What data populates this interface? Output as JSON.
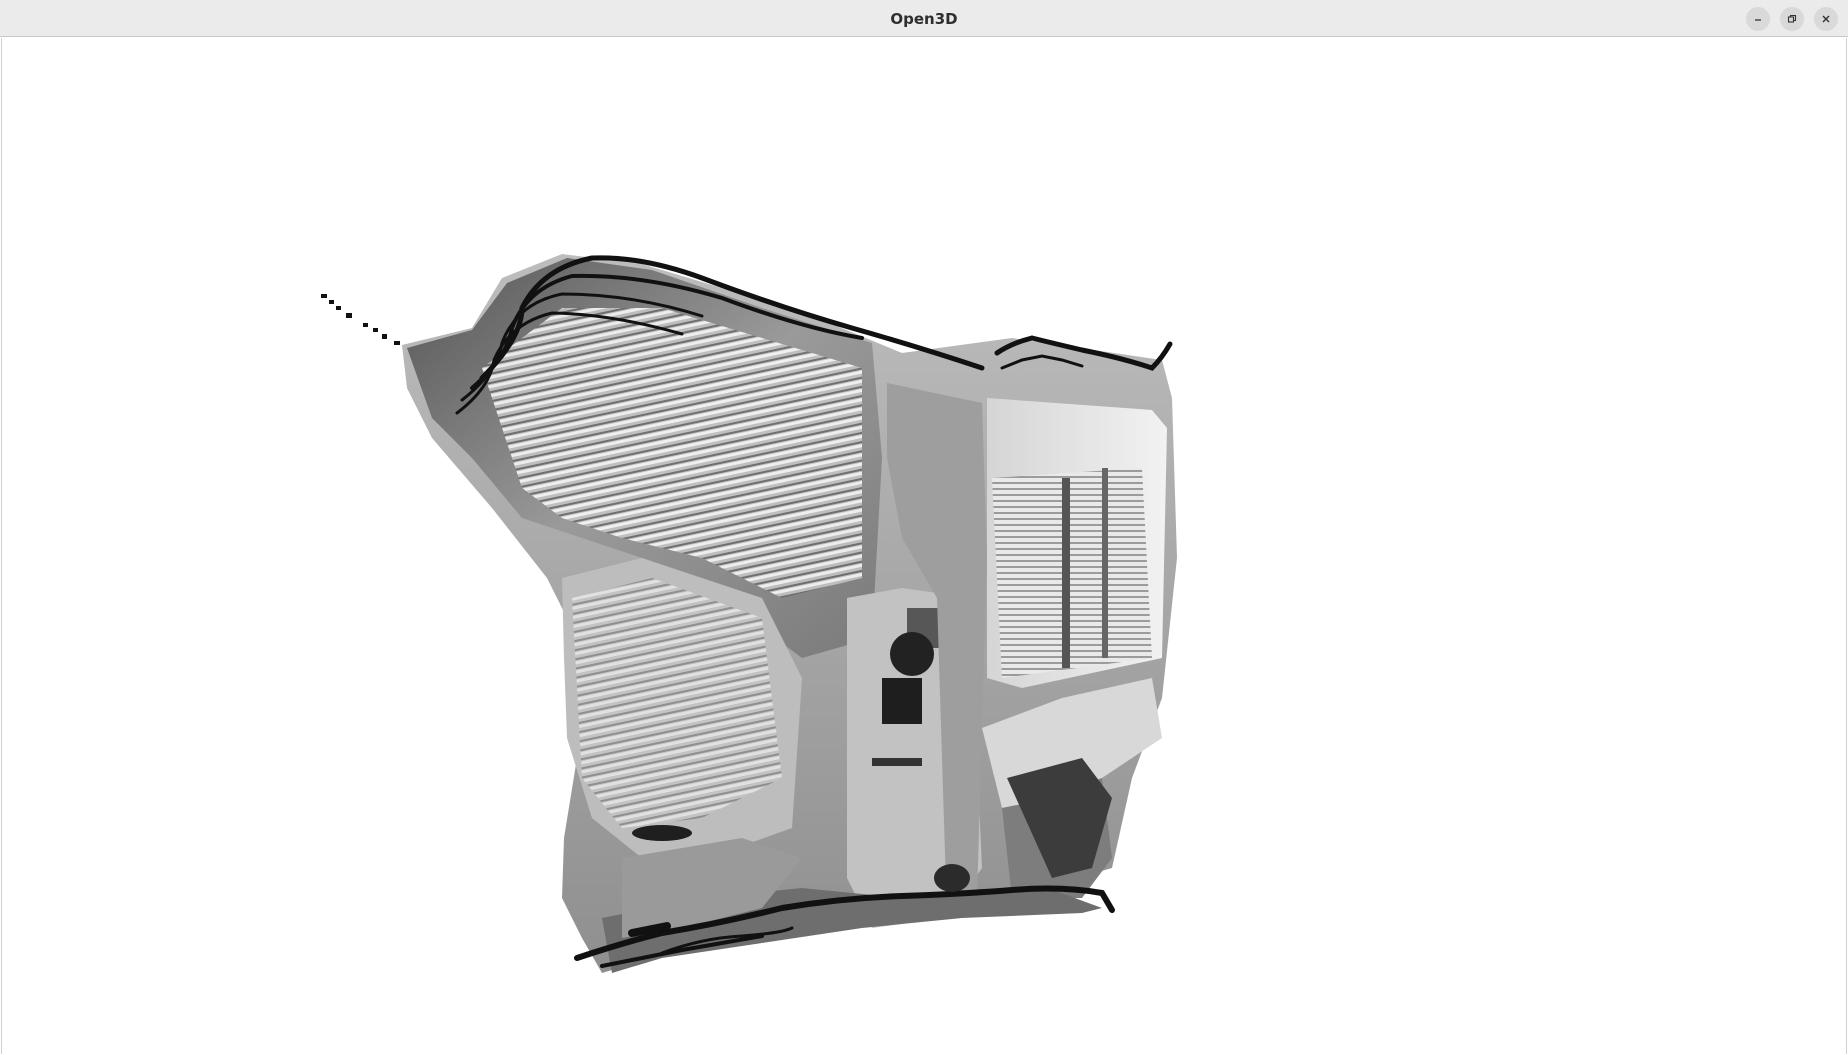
{
  "window": {
    "title": "Open3D",
    "controls": [
      {
        "name": "minimize-button",
        "icon": "minimize-icon"
      },
      {
        "name": "maximize-button",
        "icon": "restore-icon"
      },
      {
        "name": "close-button",
        "icon": "close-icon"
      }
    ]
  },
  "viewport": {
    "content": "point-cloud",
    "colors": {
      "background": "#ffffff",
      "edge": "#111111",
      "light": "#e6e6e6",
      "mid": "#8c8c8c",
      "dark": "#3a3a3a"
    }
  }
}
